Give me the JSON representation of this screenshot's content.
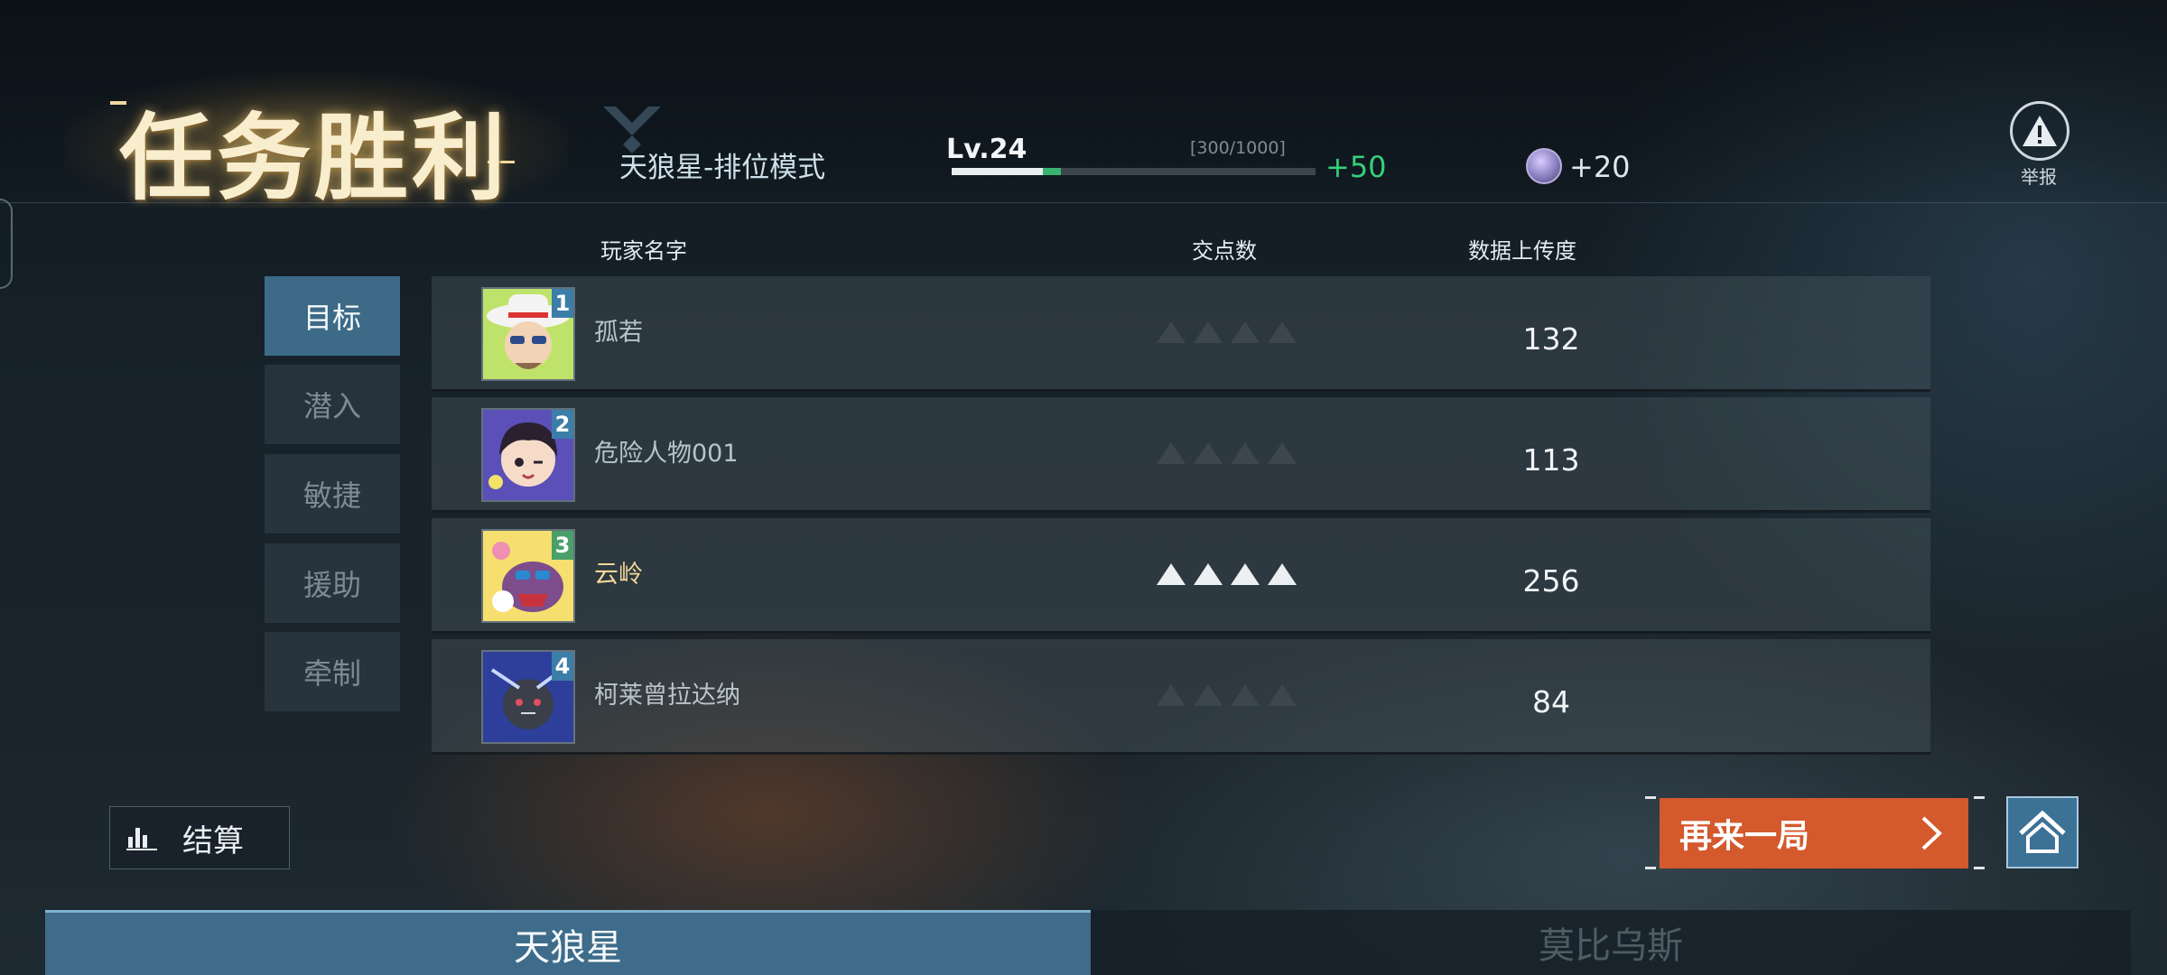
{
  "header": {
    "title": "任务胜利",
    "mode": "天狼星-排位模式",
    "level": "Lv.24",
    "xp_text": "[300/1000]",
    "xp_fraction": 0.3,
    "xp_gain_fraction": 0.05,
    "xp_gain": "+50",
    "currency_icon": "crystal-coin-icon",
    "currency_gain": "+20",
    "report_label": "举报"
  },
  "table": {
    "columns": {
      "name": "玩家名字",
      "nodes": "交点数",
      "upload": "数据上传度"
    },
    "players": [
      {
        "rank": "1",
        "name": "孤若",
        "nodes_filled": 0,
        "nodes_total": 4,
        "upload": "132",
        "avatar": "cowboy-hat-avatar",
        "highlight": false
      },
      {
        "rank": "2",
        "name": "危险人物001",
        "nodes_filled": 0,
        "nodes_total": 4,
        "upload": "113",
        "avatar": "winking-girl-avatar",
        "highlight": false
      },
      {
        "rank": "3",
        "name": "云岭",
        "nodes_filled": 4,
        "nodes_total": 4,
        "upload": "256",
        "avatar": "cool-dog-avatar",
        "highlight": true
      },
      {
        "rank": "4",
        "name": "柯莱曾拉达纳",
        "nodes_filled": 0,
        "nodes_total": 4,
        "upload": "84",
        "avatar": "bomb-robot-avatar",
        "highlight": false
      }
    ]
  },
  "side_tabs": [
    {
      "label": "目标",
      "active": true
    },
    {
      "label": "潜入",
      "active": false
    },
    {
      "label": "敏捷",
      "active": false
    },
    {
      "label": "援助",
      "active": false
    },
    {
      "label": "牵制",
      "active": false
    }
  ],
  "buttons": {
    "settle": "结算",
    "play_again": "再来一局",
    "home_icon": "home-icon"
  },
  "teams": {
    "left": "天狼星",
    "right": "莫比乌斯"
  },
  "colors": {
    "accent": "#d4592c",
    "tab_active": "#3e6c8a",
    "xp_gain": "#38b36f"
  }
}
